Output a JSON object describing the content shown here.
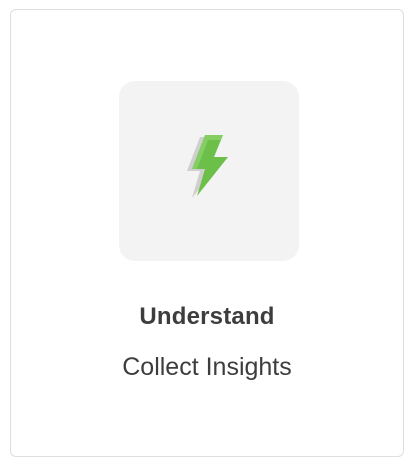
{
  "card": {
    "title": "Understand",
    "subtitle": "Collect Insights",
    "icon": "lightning-bolt-icon",
    "colors": {
      "icon_primary": "#6cc04a",
      "icon_shadow": "#cfcfcf",
      "tile_background": "#f3f3f3",
      "text": "#3d3d3d",
      "border": "#dedede"
    }
  }
}
